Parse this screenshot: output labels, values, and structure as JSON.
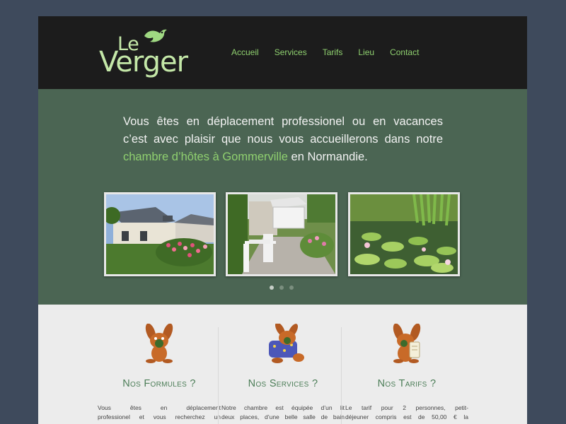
{
  "logo": {
    "line1": "Le",
    "line2": "Verger"
  },
  "nav": {
    "items": [
      {
        "label": "Accueil"
      },
      {
        "label": "Services"
      },
      {
        "label": "Tarifs"
      },
      {
        "label": "Lieu"
      },
      {
        "label": "Contact"
      }
    ]
  },
  "hero": {
    "line1": "Vous êtes en déplacement professionel ou en vacances",
    "line2": "c’est avec plaisir que nous vous accueillerons dans notre",
    "link": "chambre d’hôtes à Gommerville",
    "tail": " en Normandie."
  },
  "slider": {
    "photos": [
      "house-photo",
      "garden-terrace-photo",
      "water-lily-pond-photo"
    ],
    "dots": 3,
    "active_dot": 1
  },
  "features": [
    {
      "title": "Nos Formules ?",
      "line1": "Vous êtes en déplacement",
      "line2": "professionel et vous recherchez un"
    },
    {
      "title": "Nos Services ?",
      "line1": "Notre chambre est équipée d’un lit",
      "line2": "deux places, d’une belle salle de bain"
    },
    {
      "title": "Nos Tarifs ?",
      "line1": "Le tarif pour 2 personnes, petit-",
      "line2": "déjeuner compris est de 50,00 € la"
    }
  ],
  "colors": {
    "background": "#3e4a5c",
    "header": "#1c1c1c",
    "hero": "#4b6553",
    "accent": "#8fd06f",
    "feature_title": "#4b7d57"
  }
}
